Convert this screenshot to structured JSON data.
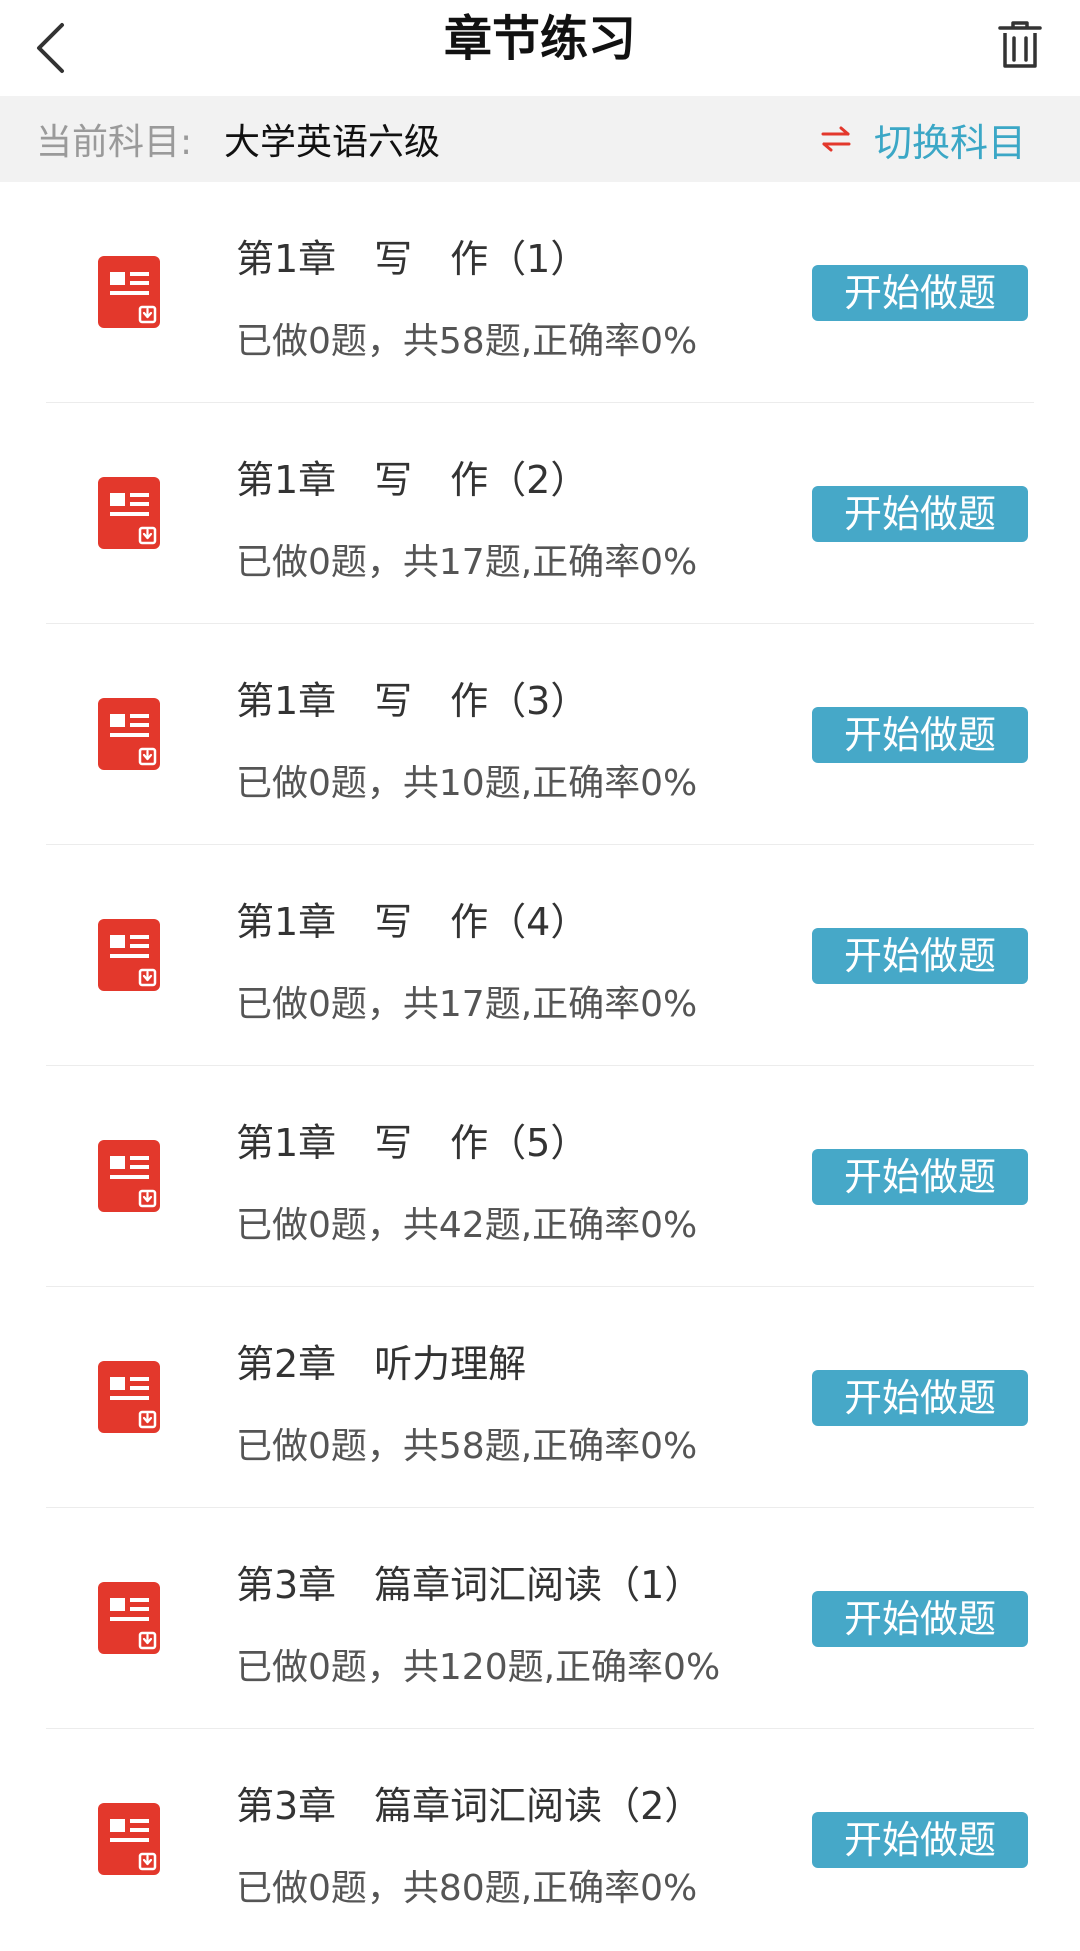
{
  "header": {
    "title": "章节练习",
    "back_icon": "chevron-left-icon",
    "trash_icon": "trash-icon"
  },
  "subject_bar": {
    "label": "当前科目:",
    "value": "大学英语六级",
    "switch_label": "切换科目",
    "switch_icon": "swap-arrows-icon"
  },
  "colors": {
    "accent": "#46a8c8",
    "link": "#3ba7c6",
    "icon_red": "#e3382c",
    "switch_arrow_red": "#e3382c"
  },
  "chapters": [
    {
      "title": "第1章　写　作（1）",
      "stats": "已做0题，共58题,正确率0%",
      "button": "开始做题"
    },
    {
      "title": "第1章　写　作（2）",
      "stats": "已做0题，共17题,正确率0%",
      "button": "开始做题"
    },
    {
      "title": "第1章　写　作（3）",
      "stats": "已做0题，共10题,正确率0%",
      "button": "开始做题"
    },
    {
      "title": "第1章　写　作（4）",
      "stats": "已做0题，共17题,正确率0%",
      "button": "开始做题"
    },
    {
      "title": "第1章　写　作（5）",
      "stats": "已做0题，共42题,正确率0%",
      "button": "开始做题"
    },
    {
      "title": "第2章　听力理解",
      "stats": "已做0题，共58题,正确率0%",
      "button": "开始做题"
    },
    {
      "title": "第3章　篇章词汇阅读（1）",
      "stats": "已做0题，共120题,正确率0%",
      "button": "开始做题"
    },
    {
      "title": "第3章　篇章词汇阅读（2）",
      "stats": "已做0题，共80题,正确率0%",
      "button": "开始做题"
    }
  ]
}
